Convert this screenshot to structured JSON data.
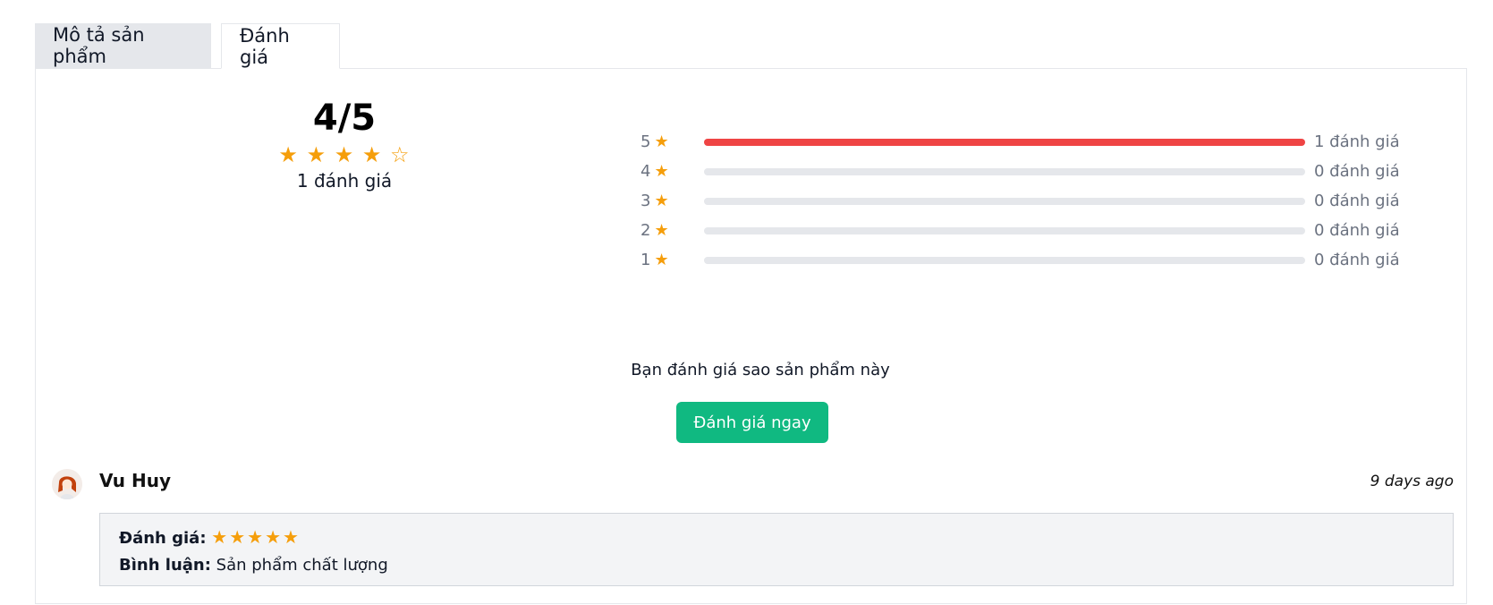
{
  "tabs": {
    "description": "Mô tả sản phẩm",
    "reviews": "Đánh giá"
  },
  "summary": {
    "score": "4/5",
    "rating_value": 4,
    "rating_max": 5,
    "count_label": "1 đánh giá"
  },
  "distribution": [
    {
      "stars": "5",
      "count_label": "1 đánh giá",
      "fraction": 1.0
    },
    {
      "stars": "4",
      "count_label": "0 đánh giá",
      "fraction": 0.0
    },
    {
      "stars": "3",
      "count_label": "0 đánh giá",
      "fraction": 0.0
    },
    {
      "stars": "2",
      "count_label": "0 đánh giá",
      "fraction": 0.0
    },
    {
      "stars": "1",
      "count_label": "0 đánh giá",
      "fraction": 0.0
    }
  ],
  "cta": {
    "prompt": "Bạn đánh giá sao sản phẩm này",
    "button": "Đánh giá ngay"
  },
  "review": {
    "user": "Vu Huy",
    "time": "9 days ago",
    "rating_label": "Đánh giá:",
    "rating_value": 5,
    "comment_label": "Bình luận:",
    "comment": "Sản phẩm chất lượng"
  },
  "colors": {
    "star": "#f59e0b",
    "bar_fill": "#ef4444",
    "bar_track": "#e5e7eb",
    "button": "#10b981"
  },
  "icons": {
    "star": "star-icon",
    "avatar": "user-avatar"
  }
}
